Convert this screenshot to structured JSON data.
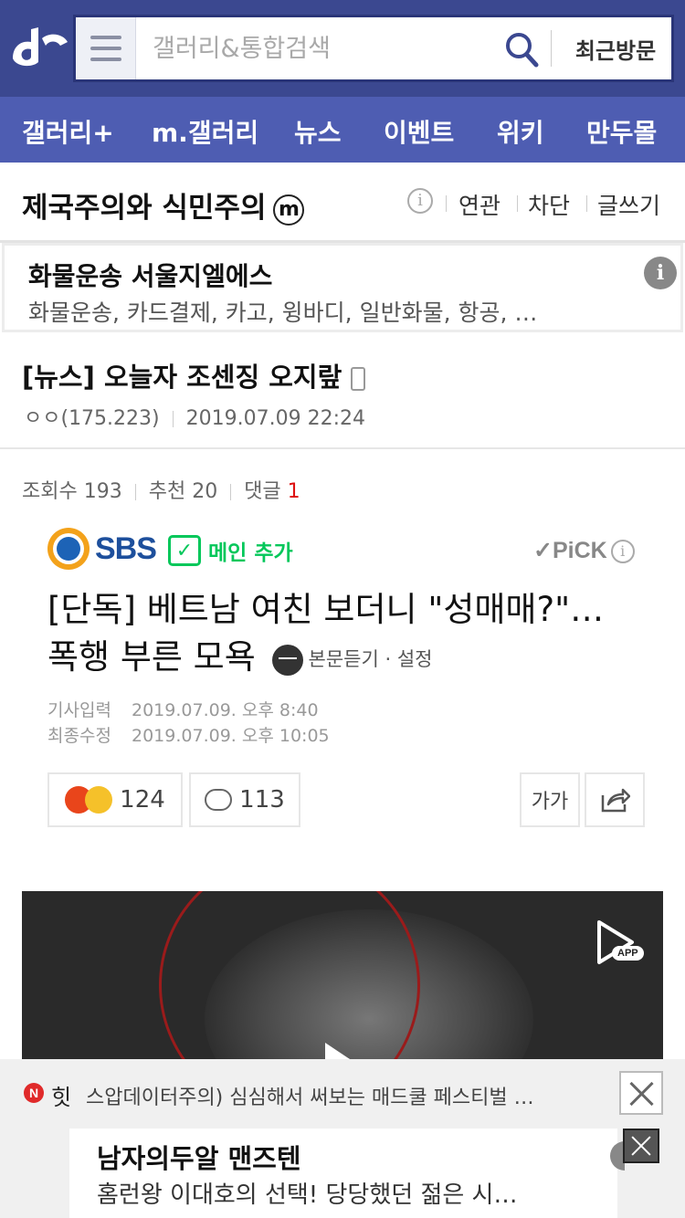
{
  "header": {
    "logo_alt": "dc",
    "search_placeholder": "갤러리&통합검색",
    "recent_label": "최근방문"
  },
  "nav": {
    "items": [
      "갤러리+",
      "m.갤러리",
      "뉴스",
      "이벤트",
      "위키",
      "만두몰"
    ]
  },
  "gallery": {
    "title": "제국주의와 식민주의",
    "badge": "m",
    "info": "i",
    "links": [
      "연관",
      "차단",
      "글쓰기"
    ]
  },
  "ad": {
    "title": "화물운송 서울지엘에스",
    "desc": "화물운송, 카드결제, 카고, 윙바디, 일반화물, 항공, …",
    "info": "i"
  },
  "post": {
    "title": "[뉴스] 오늘자 조센징 오지랖",
    "author": "ㅇㅇ(175.223)",
    "date": "2019.07.09 22:24",
    "views_label": "조회수 193",
    "recommend_label": "추천 20",
    "comments_label": "댓글",
    "comments_count": "1"
  },
  "article": {
    "press": "SBS",
    "main_add_label": "메인 추가",
    "pick_label": "✓PiCK",
    "headline": "[단독] 베트남 여친 보더니 \"성매매?\"…폭행 부른 모욕",
    "listen_label": "본문듣기 · 설정",
    "input_label": "기사입력",
    "input_date": "2019.07.09. 오후 8:40",
    "modified_label": "최종수정",
    "modified_date": "2019.07.09. 오후 10:05",
    "reaction_count": "124",
    "comment_count": "113",
    "font_size_label": "가가",
    "app_badge": "APP"
  },
  "hot": {
    "label": "힛",
    "text": "스압데이터주의) 심심해서 써보는 매드쿨 페스티벌 …"
  },
  "bottom_ad": {
    "title": "남자의두알 맨즈텐",
    "desc": "홈런왕 이대호의 선택! 당당했던 젊은 시…"
  },
  "colors": {
    "header_bg": "#3b4890",
    "nav_bg": "#4e5db2",
    "naver_green": "#03c75a",
    "comment_red": "#dd1111"
  }
}
